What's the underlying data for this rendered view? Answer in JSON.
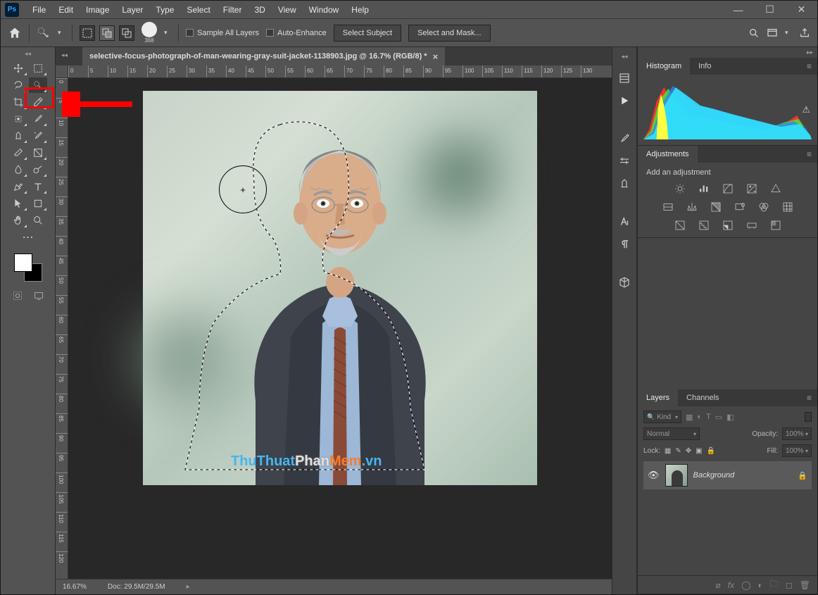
{
  "app": {
    "name": "Ps"
  },
  "menu": [
    "File",
    "Edit",
    "Image",
    "Layer",
    "Type",
    "Select",
    "Filter",
    "3D",
    "View",
    "Window",
    "Help"
  ],
  "options_bar": {
    "brush_size": "368",
    "sample_all_layers": "Sample All Layers",
    "auto_enhance": "Auto-Enhance",
    "select_subject": "Select Subject",
    "select_and_mask": "Select and Mask..."
  },
  "document": {
    "tab_title": "selective-focus-photograph-of-man-wearing-gray-suit-jacket-1138903.jpg @ 16.7% (RGB/8) *",
    "zoom": "16.67%",
    "doc_info": "Doc: 29.5M/29.5M",
    "watermark_parts": {
      "a": "ThuThuat",
      "b": "Phan",
      "c": "Mem",
      "d": ".vn"
    },
    "ruler_h": [
      "0",
      "5",
      "10",
      "15",
      "20",
      "25",
      "30",
      "35",
      "40",
      "45",
      "50",
      "55",
      "60",
      "65",
      "70",
      "75",
      "80",
      "85",
      "90",
      "95",
      "100",
      "105",
      "110",
      "115",
      "120",
      "125",
      "130"
    ],
    "ruler_v": [
      "0",
      "5",
      "10",
      "15",
      "20",
      "25",
      "30",
      "35",
      "40",
      "45",
      "50",
      "55",
      "60",
      "65",
      "70",
      "75",
      "80",
      "85",
      "90",
      "95",
      "100",
      "105",
      "110",
      "115",
      "120"
    ]
  },
  "panels": {
    "histogram": {
      "tab1": "Histogram",
      "tab2": "Info"
    },
    "adjustments": {
      "tab": "Adjustments",
      "hint": "Add an adjustment"
    },
    "layers": {
      "tab1": "Layers",
      "tab2": "Channels",
      "kind": "Kind",
      "blend_mode": "Normal",
      "opacity_label": "Opacity:",
      "opacity_value": "100%",
      "lock_label": "Lock:",
      "fill_label": "Fill:",
      "fill_value": "100%",
      "layer_name": "Background",
      "search_placeholder": "Kind"
    }
  }
}
